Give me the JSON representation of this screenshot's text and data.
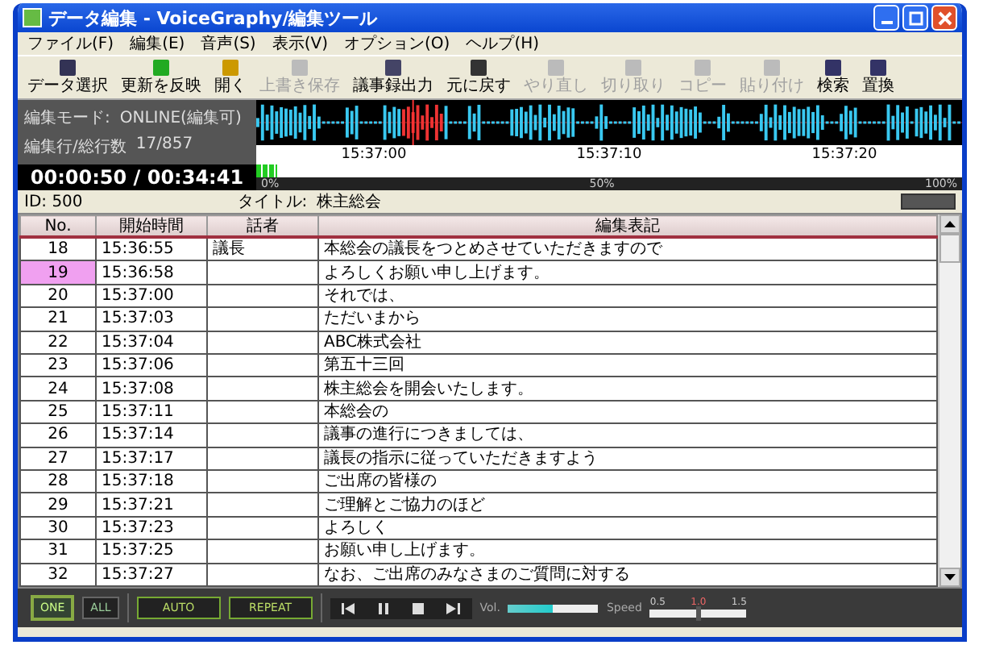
{
  "window": {
    "title": "データ編集 - VoiceGraphy/編集ツール"
  },
  "menu": [
    "ファイル(F)",
    "編集(E)",
    "音声(S)",
    "表示(V)",
    "オプション(O)",
    "ヘルプ(H)"
  ],
  "toolbar": [
    {
      "label": "データ選択",
      "disabled": false
    },
    {
      "label": "更新を反映",
      "disabled": false
    },
    {
      "label": "開く",
      "disabled": false
    },
    {
      "label": "上書き保存",
      "disabled": true
    },
    {
      "label": "議事録出力",
      "disabled": false
    },
    {
      "label": "元に戻す",
      "disabled": false
    },
    {
      "label": "やり直し",
      "disabled": true
    },
    {
      "label": "切り取り",
      "disabled": true
    },
    {
      "label": "コピー",
      "disabled": true
    },
    {
      "label": "貼り付け",
      "disabled": true
    },
    {
      "label": "検索",
      "disabled": false
    },
    {
      "label": "置換",
      "disabled": false
    }
  ],
  "info": {
    "mode_label": "編集モード:",
    "mode_value": "ONLINE(編集可)",
    "line_label": "編集行/総行数",
    "line_value": "17/857"
  },
  "waveform": {
    "times": [
      "15:37:00",
      "15:37:10",
      "15:37:20"
    ]
  },
  "time_display": "00:00:50 / 00:34:41",
  "progress": {
    "level": 0.03,
    "marks": [
      "0%",
      "50%",
      "100%"
    ]
  },
  "record": {
    "id": "ID: 500",
    "title_label": "タイトル:",
    "title_value": "株主総会"
  },
  "table": {
    "columns": [
      "No.",
      "開始時間",
      "話者",
      "編集表記"
    ],
    "rows": [
      {
        "no": "18",
        "time": "15:36:55",
        "speaker": "議長",
        "text": "本総会の議長をつとめさせていただきますので",
        "selected": false
      },
      {
        "no": "19",
        "time": "15:36:58",
        "speaker": "",
        "text": "よろしくお願い申し上げます。",
        "selected": true
      },
      {
        "no": "20",
        "time": "15:37:00",
        "speaker": "",
        "text": "それでは、",
        "selected": false
      },
      {
        "no": "21",
        "time": "15:37:03",
        "speaker": "",
        "text": "ただいまから",
        "selected": false
      },
      {
        "no": "22",
        "time": "15:37:04",
        "speaker": "",
        "text": "ABC株式会社",
        "selected": false
      },
      {
        "no": "23",
        "time": "15:37:06",
        "speaker": "",
        "text": "第五十三回",
        "selected": false
      },
      {
        "no": "24",
        "time": "15:37:08",
        "speaker": "",
        "text": "株主総会を開会いたします。",
        "selected": false
      },
      {
        "no": "25",
        "time": "15:37:11",
        "speaker": "",
        "text": "本総会の",
        "selected": false
      },
      {
        "no": "26",
        "time": "15:37:14",
        "speaker": "",
        "text": "議事の進行につきましては、",
        "selected": false
      },
      {
        "no": "27",
        "time": "15:37:17",
        "speaker": "",
        "text": "議長の指示に従っていただきますよう",
        "selected": false
      },
      {
        "no": "28",
        "time": "15:37:18",
        "speaker": "",
        "text": "ご出席の皆様の",
        "selected": false
      },
      {
        "no": "29",
        "time": "15:37:21",
        "speaker": "",
        "text": "ご理解とご協力のほど",
        "selected": false
      },
      {
        "no": "30",
        "time": "15:37:23",
        "speaker": "",
        "text": "よろしく",
        "selected": false
      },
      {
        "no": "31",
        "time": "15:37:25",
        "speaker": "",
        "text": "お願い申し上げます。",
        "selected": false
      },
      {
        "no": "32",
        "time": "15:37:27",
        "speaker": "",
        "text": "なお、ご出席のみなさまのご質問に対する",
        "selected": false
      }
    ]
  },
  "controls": {
    "range": [
      {
        "label": "ONE",
        "selected": true
      },
      {
        "label": "ALL",
        "selected": false
      }
    ],
    "modes": [
      "AUTO",
      "REPEAT"
    ],
    "volume": {
      "label": "Vol.",
      "level": 0.5
    },
    "speed": {
      "label": "Speed",
      "marks": [
        "0.5",
        "1.0",
        "1.5"
      ],
      "level": 0.5
    }
  }
}
